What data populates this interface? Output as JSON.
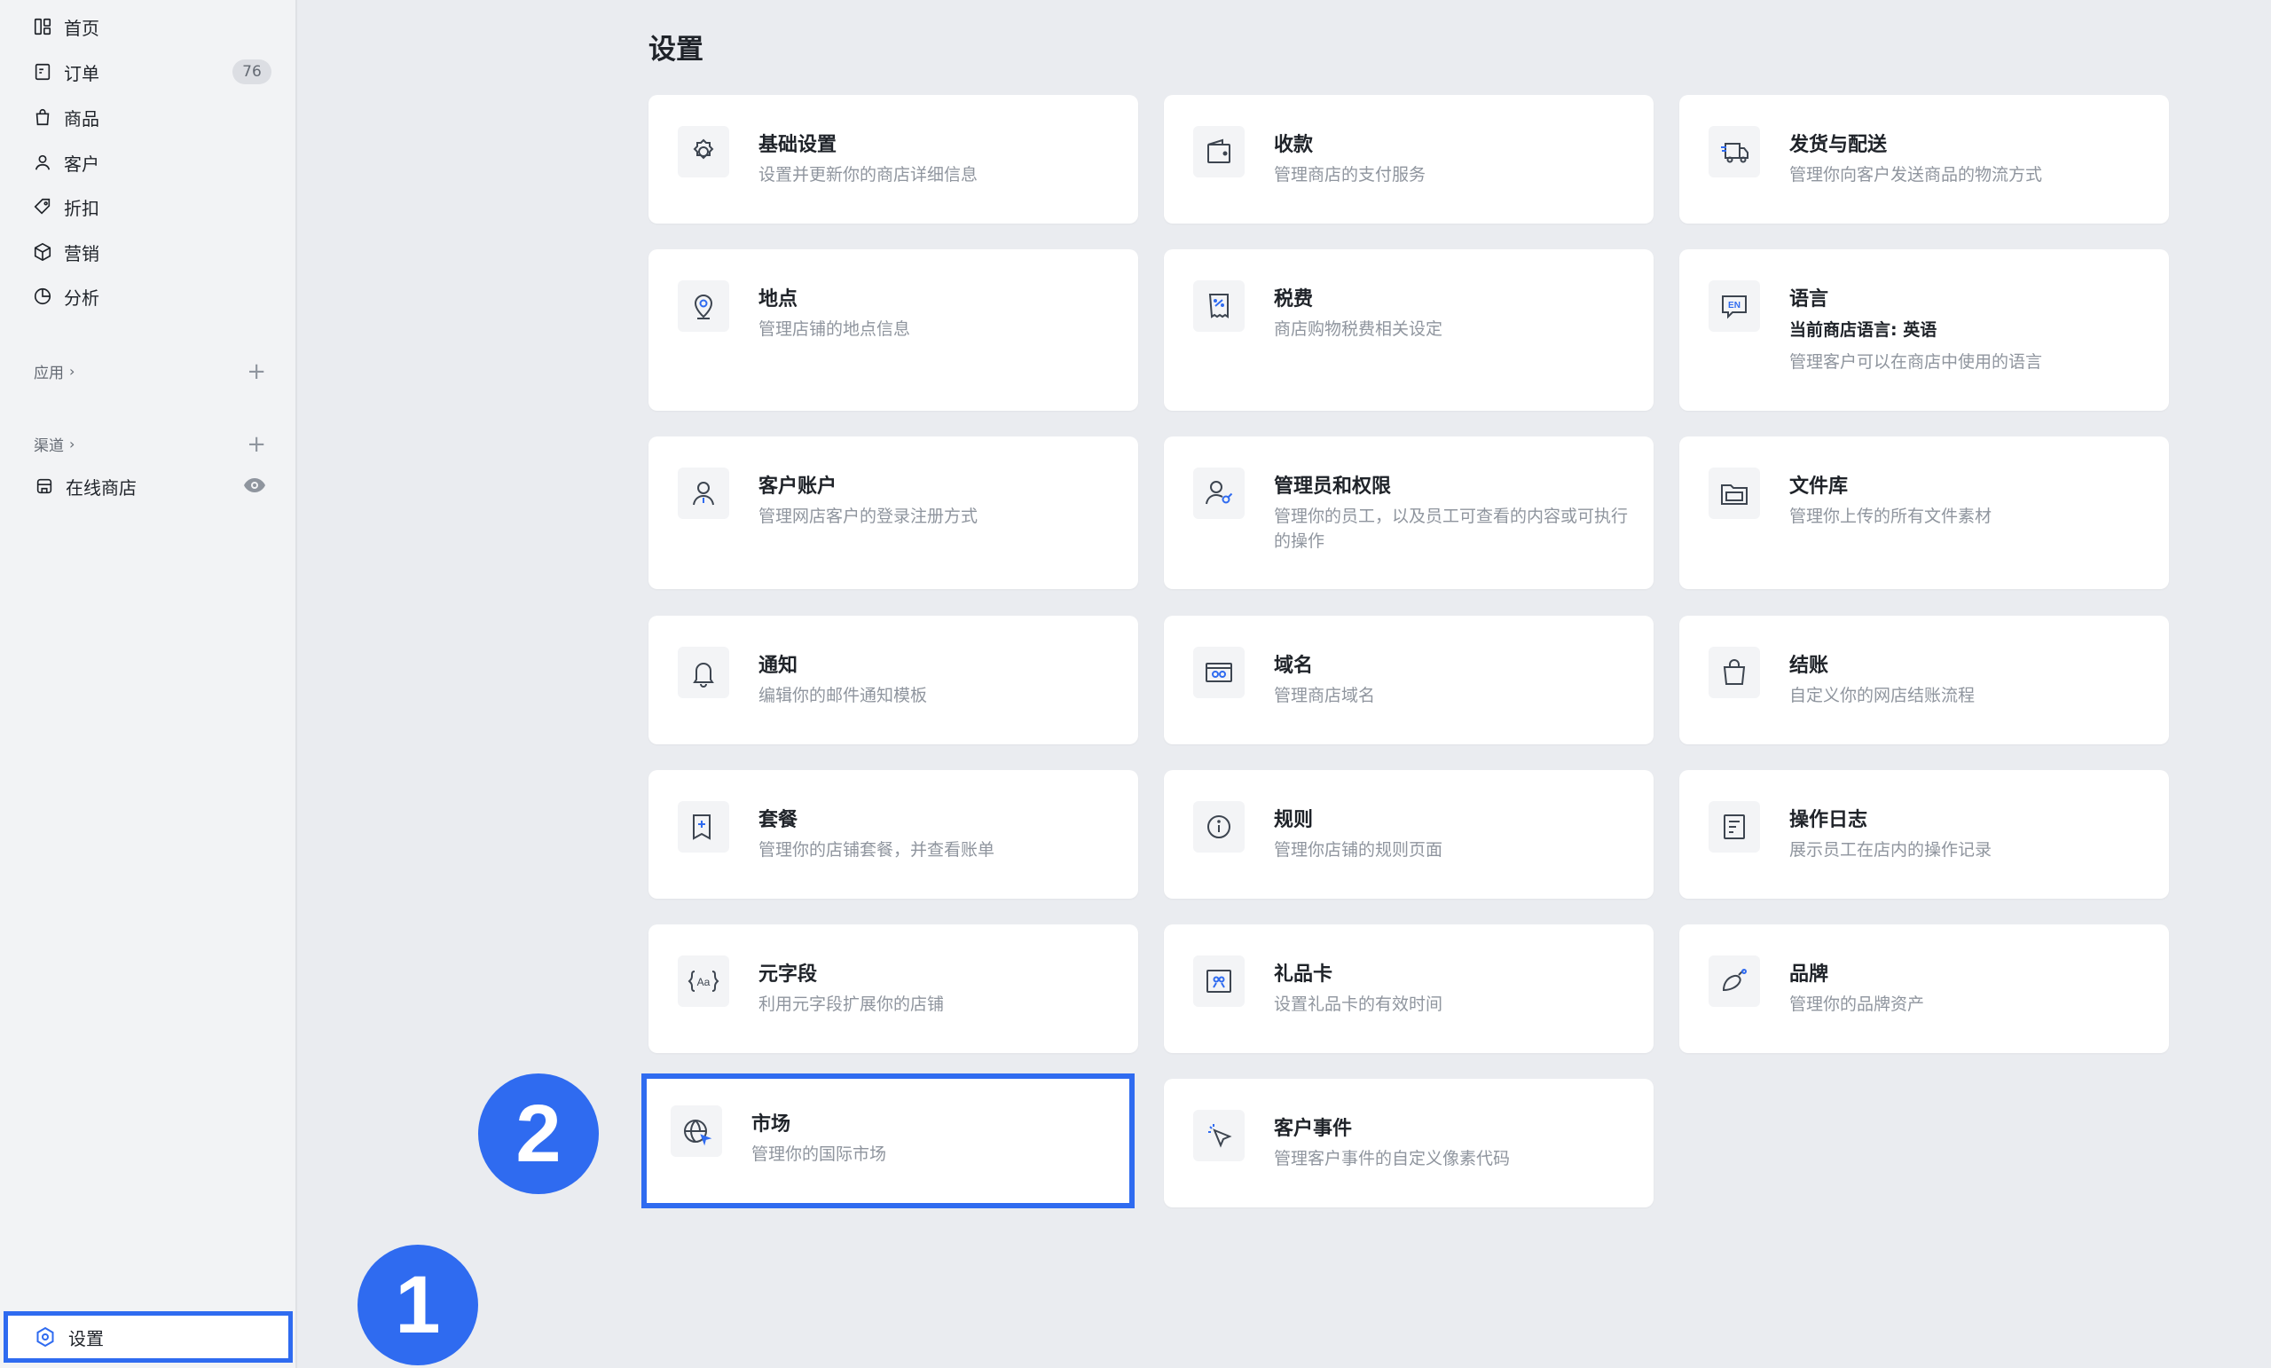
{
  "sidebar": {
    "items": [
      {
        "label": "首页",
        "icon": "dashboard-icon"
      },
      {
        "label": "订单",
        "icon": "order-icon",
        "badge": "76"
      },
      {
        "label": "商品",
        "icon": "bag-icon"
      },
      {
        "label": "客户",
        "icon": "user-icon"
      },
      {
        "label": "折扣",
        "icon": "tag-icon"
      },
      {
        "label": "营销",
        "icon": "cube-icon"
      },
      {
        "label": "分析",
        "icon": "pie-icon"
      }
    ],
    "apps_label": "应用",
    "channels_label": "渠道",
    "channels": [
      {
        "label": "在线商店",
        "icon": "store-icon"
      }
    ],
    "settings_label": "设置"
  },
  "main": {
    "title": "设置",
    "cards": [
      {
        "title": "基础设置",
        "desc": "设置并更新你的商店详细信息",
        "icon": "gear-icon"
      },
      {
        "title": "收款",
        "desc": "管理商店的支付服务",
        "icon": "wallet-icon"
      },
      {
        "title": "发货与配送",
        "desc": "管理你向客户发送商品的物流方式",
        "icon": "truck-icon"
      },
      {
        "title": "地点",
        "desc": "管理店铺的地点信息",
        "icon": "location-icon"
      },
      {
        "title": "税费",
        "desc": "商店购物税费相关设定",
        "icon": "receipt-icon"
      },
      {
        "title": "语言",
        "sub": "当前商店语言: 英语",
        "desc": "管理客户可以在商店中使用的语言",
        "icon": "language-icon"
      },
      {
        "title": "客户账户",
        "desc": "管理网店客户的登录注册方式",
        "icon": "account-icon"
      },
      {
        "title": "管理员和权限",
        "desc": "管理你的员工，以及员工可查看的内容或可执行的操作",
        "icon": "admin-icon"
      },
      {
        "title": "文件库",
        "desc": "管理你上传的所有文件素材",
        "icon": "folder-icon"
      },
      {
        "title": "通知",
        "desc": "编辑你的邮件通知模板",
        "icon": "bell-icon"
      },
      {
        "title": "域名",
        "desc": "管理商店域名",
        "icon": "domain-icon"
      },
      {
        "title": "结账",
        "desc": "自定义你的网店结账流程",
        "icon": "checkout-bag-icon"
      },
      {
        "title": "套餐",
        "desc": "管理你的店铺套餐，并查看账单",
        "icon": "plan-icon"
      },
      {
        "title": "规则",
        "desc": "管理你店铺的规则页面",
        "icon": "info-icon"
      },
      {
        "title": "操作日志",
        "desc": "展示员工在店内的操作记录",
        "icon": "log-icon"
      },
      {
        "title": "元字段",
        "desc": "利用元字段扩展你的店铺",
        "icon": "metafield-icon"
      },
      {
        "title": "礼品卡",
        "desc": "设置礼品卡的有效时间",
        "icon": "gift-card-icon"
      },
      {
        "title": "品牌",
        "desc": "管理你的品牌资产",
        "icon": "brand-icon"
      },
      {
        "title": "市场",
        "desc": "管理你的国际市场",
        "icon": "globe-icon"
      },
      {
        "title": "客户事件",
        "desc": "管理客户事件的自定义像素代码",
        "icon": "cursor-icon"
      }
    ]
  },
  "markers": {
    "step1": "1",
    "step2": "2"
  },
  "colors": {
    "accent": "#2f6bf0",
    "background": "#eaecf0",
    "sidebar": "#f2f3f5",
    "card": "#ffffff"
  }
}
